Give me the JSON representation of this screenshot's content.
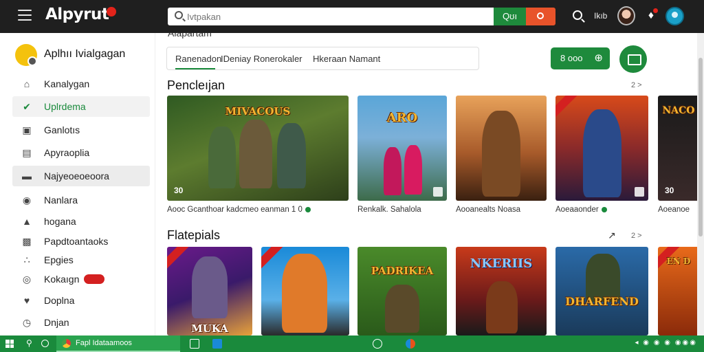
{
  "topbar": {
    "logo": "Alpyrut",
    "search_placeholder": "Ivtpakan",
    "search_go_label": "Qʊı",
    "user_label": "Ikıb"
  },
  "sidebar": {
    "brand_label": "Aplhıı Ivialgagan",
    "items": [
      {
        "label": "Kanalygan",
        "icon": "home-icon"
      },
      {
        "label": "Uplrdema",
        "icon": "check-icon"
      },
      {
        "label": "Ganlotıs",
        "icon": "chart-icon"
      },
      {
        "label": "Apyraoplia",
        "icon": "list-icon"
      },
      {
        "label": "Najyeoeoeoora",
        "icon": "inbox-icon"
      },
      {
        "label": "Nanlara",
        "icon": "globe-icon"
      },
      {
        "label": "hogana",
        "icon": "alert-icon"
      },
      {
        "label": "Papdtoantaoks",
        "icon": "bar-chart-icon"
      },
      {
        "label": "Epgies",
        "icon": "people-icon"
      },
      {
        "label": "Kokaıgn",
        "icon": "target-icon"
      },
      {
        "label": "Doplna",
        "icon": "heart-icon"
      },
      {
        "label": "Dnjan",
        "icon": "clock-icon"
      }
    ]
  },
  "main": {
    "cut_heading": "Alapartam",
    "tabs": [
      "Ranenadon",
      "IDeniay Ronerokaler",
      "Hkeraan Namant"
    ],
    "green_button_label": "8 ooo",
    "section1": {
      "title": "Pencleıjan",
      "more": "2 >",
      "cards": [
        {
          "art_title": "MIVACOUS",
          "score": "30",
          "caption": "Aooc Gcanthoar kadcmeo eanman 1 0"
        },
        {
          "art_title": "ARO",
          "score": "",
          "caption": "Renkalk. Sahalola"
        },
        {
          "art_title": "",
          "score": "",
          "caption": "Aooanealts Noasa"
        },
        {
          "art_title": "",
          "score": "",
          "caption": "Aoeaaonder"
        },
        {
          "art_title": "NACO",
          "score": "30",
          "caption": "Aoeanoe"
        }
      ]
    },
    "section2": {
      "title": "Flatepials",
      "more": "2 >",
      "cards": [
        {
          "art_title": "MUKA"
        },
        {
          "art_title": ""
        },
        {
          "art_title": "PADRIKEA"
        },
        {
          "art_title": "NKERIIS"
        },
        {
          "art_title": "DHARFEND"
        },
        {
          "art_title": "EN D"
        }
      ]
    }
  },
  "taskbar": {
    "app_label": "Fapl Idataamoos",
    "tray": "◂ ◉ ◉ ◉ ◉◉◉"
  }
}
